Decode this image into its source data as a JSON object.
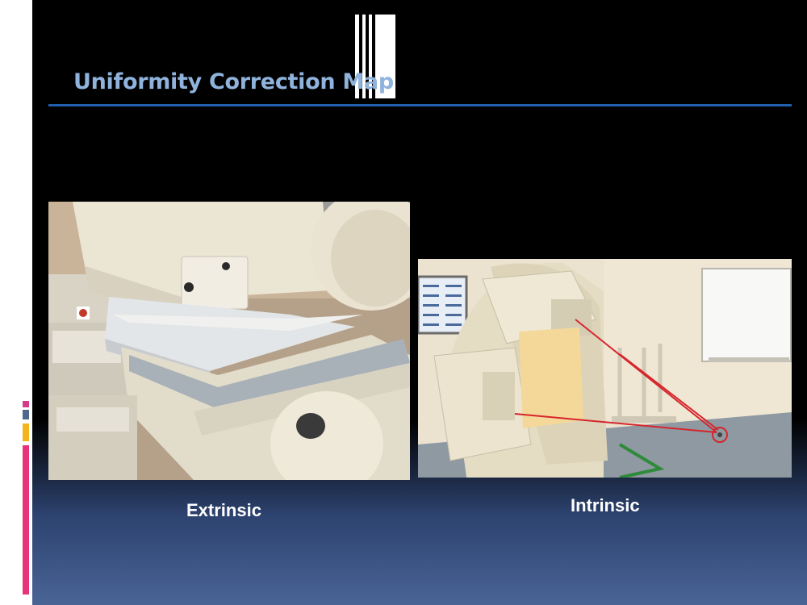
{
  "slide": {
    "title": "Uniformity Correction Map",
    "accent_color": "#1f5fae",
    "title_color": "#8fb3dc"
  },
  "figures": [
    {
      "caption": "Extrinsic",
      "image": "gamma-camera-with-collimator-photo"
    },
    {
      "caption": "Intrinsic",
      "image": "gamma-camera-intrinsic-setup-photo"
    }
  ],
  "decor": {
    "strip_colors": [
      "#d63a8a",
      "#4d6a8c",
      "#f2b51a",
      "#e8327a"
    ]
  }
}
